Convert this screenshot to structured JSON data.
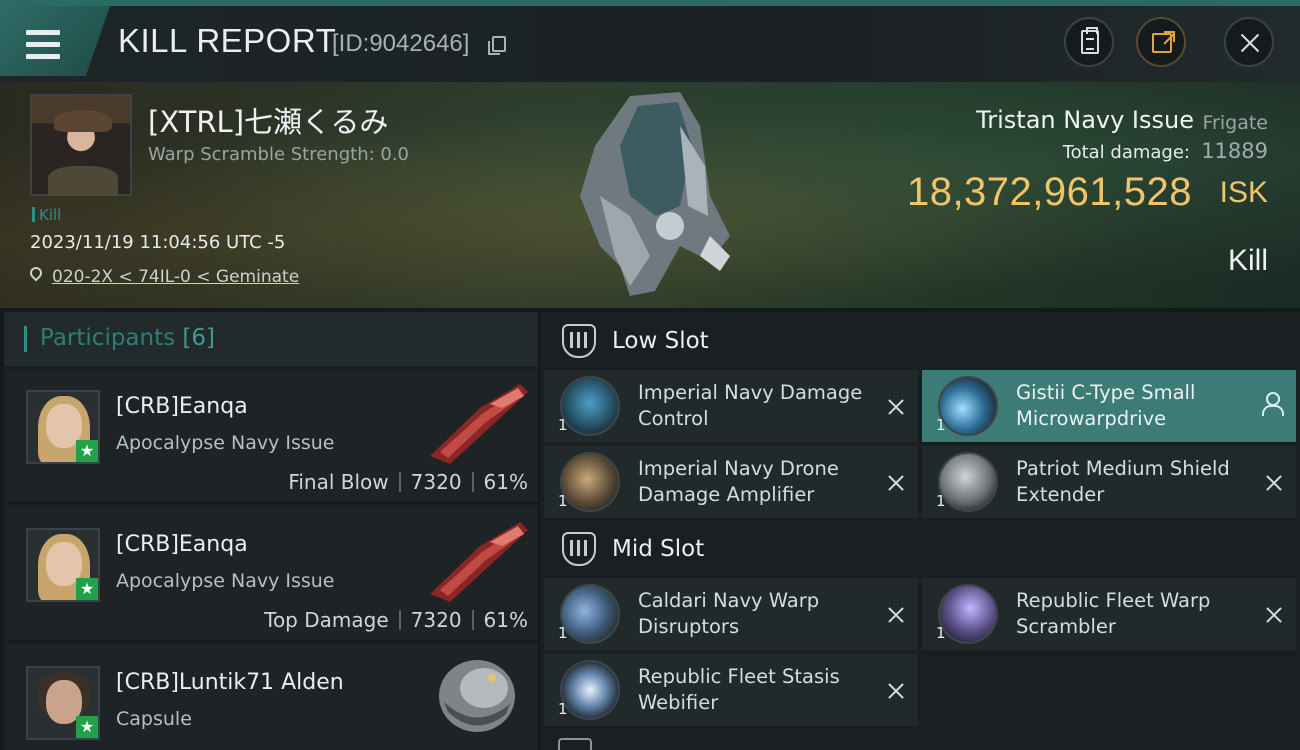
{
  "header": {
    "title": "KILL REPORT",
    "report_id": "[ID:9042646]"
  },
  "victim": {
    "name": "[XTRL]七瀬くるみ",
    "warp_scramble_label": "Warp Scramble Strength: 0.0",
    "tag": "Kill",
    "datetime": "2023/11/19 11:04:56 UTC -5",
    "location": "020-2X < 74IL-0 < Geminate"
  },
  "ship": {
    "name": "Tristan Navy Issue",
    "class": "Frigate",
    "total_damage_label": "Total damage:",
    "total_damage": "11889",
    "isk_value": "18,372,961,528",
    "isk_unit": "ISK",
    "result": "Kill"
  },
  "participants": {
    "title": "Participants",
    "count": "[6]",
    "items": [
      {
        "name": "[CRB]Eanqa",
        "ship": "Apocalypse Navy Issue",
        "role": "Final Blow",
        "damage": "7320",
        "percent": "61%"
      },
      {
        "name": "[CRB]Eanqa",
        "ship": "Apocalypse Navy Issue",
        "role": "Top Damage",
        "damage": "7320",
        "percent": "61%"
      },
      {
        "name": "[CRB]Luntik71 Alden",
        "ship": "Capsule"
      }
    ]
  },
  "fitting": {
    "low_slot": {
      "title": "Low Slot",
      "modules": [
        {
          "name": "Imperial Navy Damage Control",
          "qty": "1"
        },
        {
          "name": "Gistii C-Type Small Microwarpdrive",
          "qty": "1"
        },
        {
          "name": "Imperial Navy Drone Damage Amplifier",
          "qty": "1"
        },
        {
          "name": "Patriot Medium Shield Extender",
          "qty": "1"
        }
      ]
    },
    "mid_slot": {
      "title": "Mid Slot",
      "modules": [
        {
          "name": "Caldari Navy Warp Disruptors",
          "qty": "1"
        },
        {
          "name": "Republic Fleet Warp Scrambler",
          "qty": "1"
        },
        {
          "name": "Republic Fleet Stasis Webifier",
          "qty": "1"
        }
      ]
    }
  },
  "colors": {
    "accent_teal": "#2f8e86",
    "isk_gold": "#f2c46a",
    "active_row": "#3d7b76",
    "badge_green": "#21a24a"
  },
  "icons": {
    "menu": "hamburger-icon",
    "copy": "copy-icon",
    "clipboard": "clipboard-icon",
    "share": "share-icon",
    "close": "close-icon",
    "location": "map-pin-icon",
    "slot": "slot-icon",
    "remove": "x-icon",
    "user": "user-icon",
    "star": "star-icon"
  }
}
